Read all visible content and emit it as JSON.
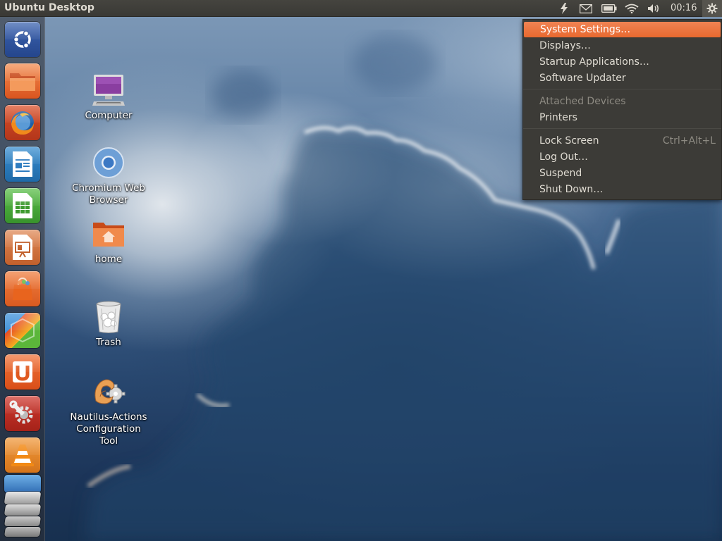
{
  "panel": {
    "title": "Ubuntu Desktop",
    "clock": "00:16"
  },
  "launcher": {
    "items": [
      {
        "name": "dash-home",
        "icon": "ubuntu-logo-icon"
      },
      {
        "name": "files",
        "icon": "folder-icon"
      },
      {
        "name": "firefox",
        "icon": "firefox-icon"
      },
      {
        "name": "libreoffice-writer",
        "icon": "writer-icon"
      },
      {
        "name": "libreoffice-calc",
        "icon": "calc-icon"
      },
      {
        "name": "libreoffice-impress",
        "icon": "impress-icon"
      },
      {
        "name": "software-center",
        "icon": "shopping-bag-icon"
      },
      {
        "name": "app-cube",
        "icon": "cube-icon"
      },
      {
        "name": "ubuntu-one",
        "icon": "ubuntu-one-icon"
      },
      {
        "name": "system-settings",
        "icon": "wrench-icon"
      },
      {
        "name": "vlc",
        "icon": "vlc-cone-icon"
      },
      {
        "name": "workspace-switcher",
        "icon": "stack-icon"
      }
    ]
  },
  "desktop": {
    "icons": [
      {
        "label": "Computer",
        "icon": "computer-icon"
      },
      {
        "label": "Chromium Web Browser",
        "icon": "chromium-icon"
      },
      {
        "label": "home",
        "icon": "home-folder-icon"
      },
      {
        "label": "Trash",
        "icon": "trash-icon"
      },
      {
        "label": "Nautilus-Actions Configuration Tool",
        "icon": "shell-gear-icon"
      }
    ]
  },
  "menu": {
    "system_settings": "System Settings…",
    "displays": "Displays…",
    "startup_apps": "Startup Applications…",
    "software_updater": "Software Updater",
    "attached_devices": "Attached Devices",
    "printers": "Printers",
    "lock_screen": "Lock Screen",
    "lock_shortcut": "Ctrl+Alt+L",
    "log_out": "Log Out…",
    "suspend": "Suspend",
    "shut_down": "Shut Down…"
  },
  "colors": {
    "accent": "#e9692f",
    "panel": "#3c3b37",
    "menu_text": "#dfdbd2"
  }
}
